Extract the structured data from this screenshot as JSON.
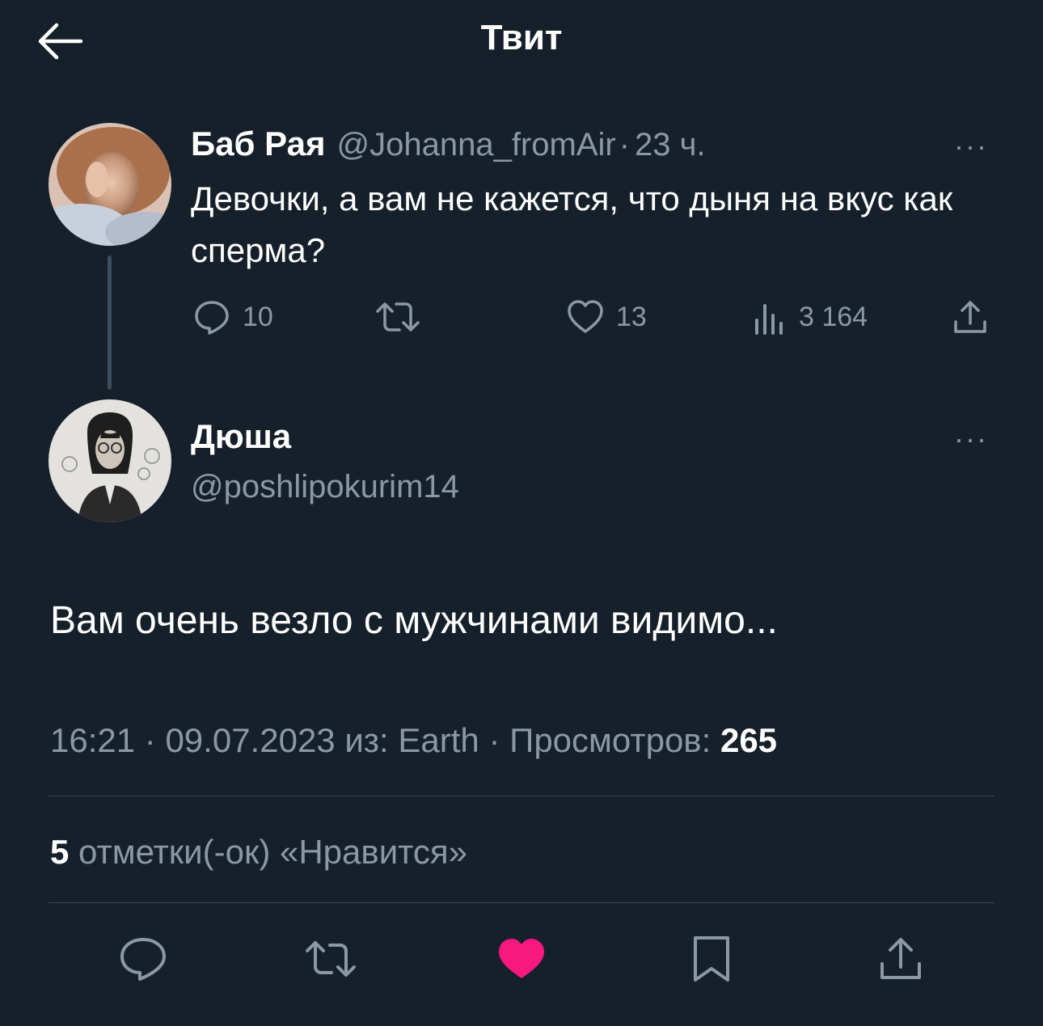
{
  "header": {
    "title": "Твит"
  },
  "parent_tweet": {
    "author_name": "Баб Рая",
    "author_handle": "@Johanna_fromAir",
    "separator": "·",
    "time_ago": "23 ч.",
    "text": "Девочки, а вам не кажется, что дыня на вкус как сперма?",
    "more_label": "···",
    "stats": {
      "replies": "10",
      "likes": "13",
      "views": "3 164"
    }
  },
  "reply_tweet": {
    "author_name": "Дюша",
    "author_handle": "@poshlipokurim14",
    "more_label": "···",
    "text": "Вам очень везло с мужчинами видимо...",
    "time": "16:21",
    "date": "09.07.2023",
    "source_label": "из: Earth",
    "views_label": "Просмотров:",
    "views_count": "265",
    "separator": "·",
    "likes_count": "5",
    "likes_label": "отметки(-ок) «Нравится»"
  },
  "colors": {
    "background": "#15202b",
    "secondary_text": "#8b98a5",
    "divider": "#38444d",
    "like_active": "#f91880"
  }
}
